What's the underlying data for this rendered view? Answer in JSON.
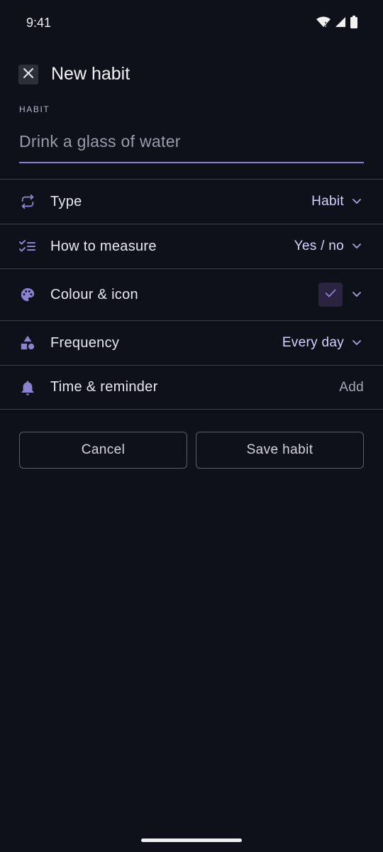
{
  "status_bar": {
    "time": "9:41",
    "icons": [
      "wifi-icon",
      "signal-icon",
      "battery-icon"
    ]
  },
  "header": {
    "close_icon": "close-icon",
    "title": "New habit"
  },
  "habit_field": {
    "label": "HABIT",
    "value": "",
    "placeholder": "Drink a glass of water"
  },
  "rows": [
    {
      "label": "Type",
      "value": "Habit",
      "icon": "repeat-icon"
    },
    {
      "label": "How to measure",
      "value": "Yes / no",
      "icon": "checklist-icon"
    },
    {
      "label": "Colour & icon",
      "value": "",
      "icon": "palette-icon",
      "swatch_color": "#2a2441",
      "swatch_icon": "check-icon"
    },
    {
      "label": "Frequency",
      "value": "Every day",
      "icon": "shapes-icon"
    },
    {
      "label": "Time & reminder",
      "value": "Add",
      "icon": "bell-icon"
    }
  ],
  "actions": {
    "cancel_label": "Cancel",
    "save_label": "Save habit"
  },
  "colors": {
    "background": "#0f111a",
    "accent": "#8b83d0",
    "value_text": "#d6d2ff"
  }
}
